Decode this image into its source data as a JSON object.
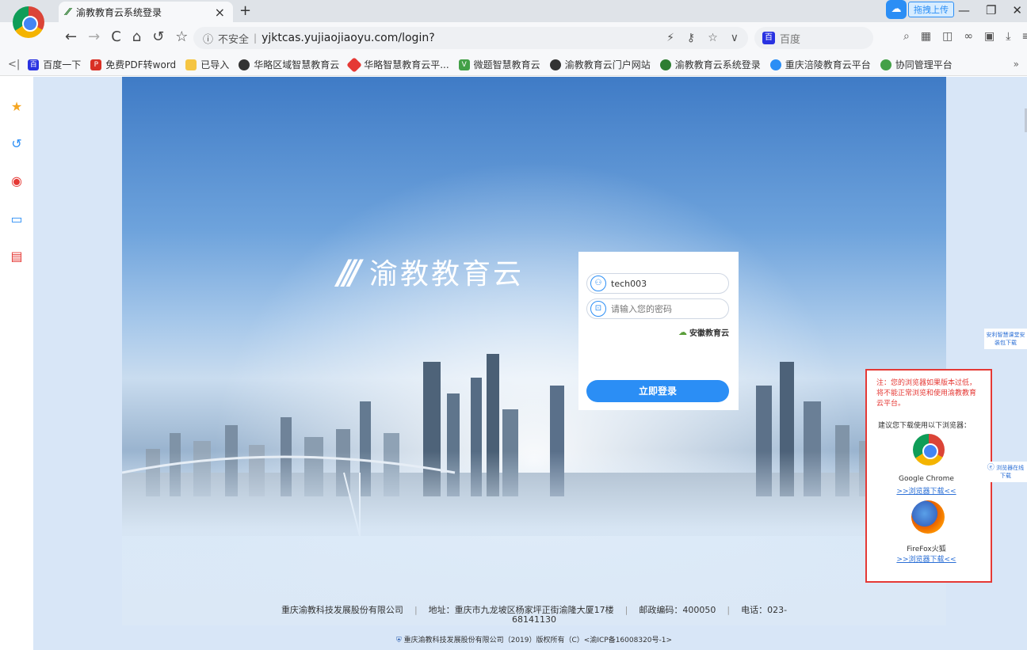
{
  "browser": {
    "tab_title": "渝教教育云系统登录",
    "tab_close": "×",
    "new_tab": "+",
    "window_controls": [
      "⧉",
      "—",
      "❐",
      "✕"
    ],
    "nav": [
      "←",
      "→",
      "C",
      "⌂",
      "↺",
      "☆"
    ],
    "insecure_label": "不安全",
    "url": "yjktcas.yujiaojiaoyu.com/login?",
    "search_engine": "百度",
    "upload_label": "拖拽上传"
  },
  "bookmarks": {
    "items": [
      {
        "label": "百度一下",
        "color": "#2932e1"
      },
      {
        "label": "免费PDF转word",
        "color": "#d93025"
      },
      {
        "label": "已导入",
        "color": "#f5c542"
      },
      {
        "label": "华略区域智慧教育云",
        "color": "#333333"
      },
      {
        "label": "华略智慧教育云平...",
        "color": "#e53935"
      },
      {
        "label": "微题智慧教育云",
        "color": "#43a047"
      },
      {
        "label": "渝教教育云门户网站",
        "color": "#333333"
      },
      {
        "label": "渝教教育云系统登录",
        "color": "#2e7d32"
      },
      {
        "label": "重庆涪陵教育云平台",
        "color": "#2b8ef5"
      },
      {
        "label": "协同管理平台",
        "color": "#43a047"
      }
    ],
    "more": "»"
  },
  "sidebar": {
    "icons": [
      "star-icon",
      "history-icon",
      "weibo-icon",
      "reader-icon",
      "pdf-icon"
    ]
  },
  "brand": {
    "name": "渝教教育云"
  },
  "login": {
    "username_value": "tech003",
    "password_placeholder": "请输入您的密码",
    "org_name": "安徽教育云",
    "submit_label": "立即登录"
  },
  "notice": {
    "warning": "注：您的浏览器如果版本过低，将不能正常浏览和使用渝教教育云平台。",
    "suggest": "建议您下载使用以下浏览器：",
    "chrome_name": "Google Chrome",
    "chrome_download": ">>浏览器下载<<",
    "firefox_name": "FireFox火狐",
    "firefox_download": ">>浏览器下载<<"
  },
  "floating": {
    "app_download": "安利智慧课堂安装包下载",
    "browser_download": "浏览器在线下载"
  },
  "footer": {
    "company": "重庆渝教科技发展股份有限公司",
    "address": "地址：重庆市九龙坡区杨家坪正街渝隆大厦17楼",
    "postcode": "邮政编码：400050",
    "phone_label": "电话：023-",
    "phone_number": "68141130",
    "copyright": "重庆渝教科技发展股份有限公司（2019）版权所有（C）<渝ICP备16008320号-1>"
  }
}
